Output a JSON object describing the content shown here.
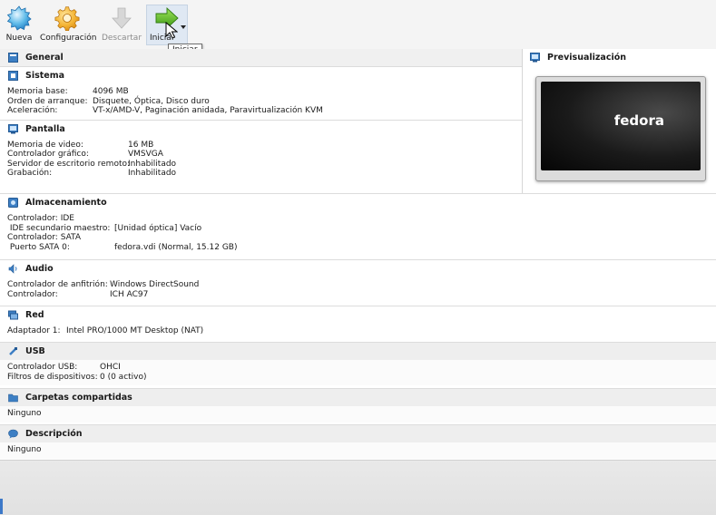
{
  "toolbar": {
    "nueva": "Nueva",
    "configuracion": "Configuración",
    "descartar": "Descartar",
    "iniciar": "Iniciar",
    "tooltip": "Iniciar"
  },
  "general": {
    "title": "General"
  },
  "sistema": {
    "title": "Sistema",
    "rows": [
      {
        "k": "Memoria base:",
        "v": "4096 MB"
      },
      {
        "k": "Orden de arranque:",
        "v": "Disquete, Óptica, Disco duro"
      },
      {
        "k": "Aceleración:",
        "v": "VT-x/AMD-V, Paginación anidada, Paravirtualización KVM"
      }
    ]
  },
  "pantalla": {
    "title": "Pantalla",
    "rows": [
      {
        "k": "Memoria de video:",
        "v": "16 MB"
      },
      {
        "k": "Controlador gráfico:",
        "v": "VMSVGA"
      },
      {
        "k": "Servidor de escritorio remoto:",
        "v": "Inhabilitado"
      },
      {
        "k": "Grabación:",
        "v": "Inhabilitado"
      }
    ]
  },
  "almacenamiento": {
    "title": "Almacenamiento",
    "c1": "Controlador: IDE",
    "r1k": " IDE secundario maestro:",
    "r1v": "[Unidad óptica] Vacío",
    "c2": "Controlador: SATA",
    "r2k": " Puerto SATA 0:",
    "r2v": "fedora.vdi (Normal, 15.12 GB)"
  },
  "audio": {
    "title": "Audio",
    "rows": [
      {
        "k": "Controlador de anfitrión:",
        "v": "Windows DirectSound"
      },
      {
        "k": "Controlador:",
        "v": "ICH AC97"
      }
    ]
  },
  "red": {
    "title": "Red",
    "k": "Adaptador 1:",
    "v": "Intel PRO/1000 MT Desktop (NAT)"
  },
  "usb": {
    "title": "USB",
    "rows": [
      {
        "k": "Controlador USB:",
        "v": "OHCI"
      },
      {
        "k": "Filtros de dispositivos:",
        "v": "0 (0 activo)"
      }
    ]
  },
  "carpetas": {
    "title": "Carpetas compartidas",
    "value": "Ninguno"
  },
  "descripcion": {
    "title": "Descripción",
    "value": "Ninguno"
  },
  "preview": {
    "title": "Previsualización",
    "vm_name": "fedora"
  },
  "colors": {
    "accent": "#3c78c8",
    "start_green": "#5fb82a",
    "gear_orange": "#f0a020"
  }
}
